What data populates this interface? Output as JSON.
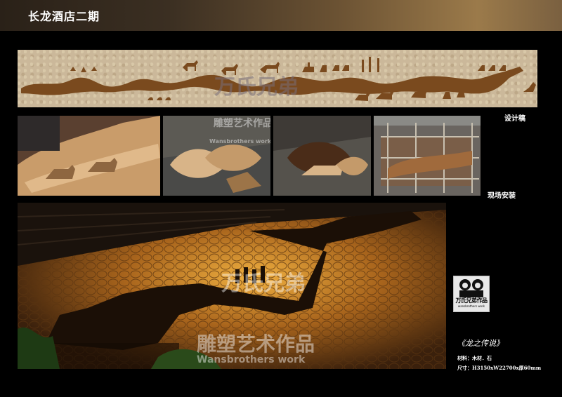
{
  "header": {
    "title": "长龙酒店二期"
  },
  "sections": {
    "design_label": "设计稿",
    "install_label": "现场安装"
  },
  "watermarks": {
    "brand_cn": "万氏兄弟",
    "brand_art": "雕塑艺术作品",
    "brand_en": "Wansbrothers work"
  },
  "logo": {
    "title": "万氏兄弟作品",
    "subtitle": "wansbrothers work"
  },
  "artwork": {
    "title": "《龙之传说》",
    "material_label": "材料：木材．石",
    "size_label": "尺寸：H3150xW22700x厚60mm"
  },
  "colors": {
    "header_gradient_end": "#9b7a4a",
    "silhouette": "#7a4a1e",
    "background": "#000000"
  }
}
